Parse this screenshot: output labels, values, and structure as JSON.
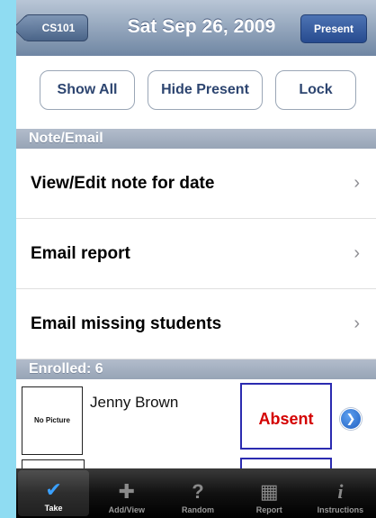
{
  "navbar": {
    "back_label": "CS101",
    "title": "Sat Sep 26, 2009",
    "present_label": "Present"
  },
  "actions": {
    "show_all": "Show All",
    "hide_present": "Hide Present",
    "lock": "Lock"
  },
  "note_section": {
    "header": "Note/Email",
    "items": [
      {
        "label": "View/Edit note for date"
      },
      {
        "label": "Email report"
      },
      {
        "label": "Email missing students"
      }
    ]
  },
  "enrolled": {
    "header": "Enrolled: 6",
    "students": [
      {
        "name": "Jenny Brown",
        "picture_text": "No Picture",
        "status": "Absent"
      }
    ]
  },
  "tabbar": {
    "tabs": [
      {
        "label": "Take",
        "icon": "checkmark-icon",
        "active": true
      },
      {
        "label": "Add/View",
        "icon": "add-person-icon",
        "active": false
      },
      {
        "label": "Random",
        "icon": "question-icon",
        "active": false
      },
      {
        "label": "Report",
        "icon": "grid-icon",
        "active": false
      },
      {
        "label": "Instructions",
        "icon": "info-icon",
        "active": false
      }
    ]
  },
  "colors": {
    "background": "#8fdcf2",
    "absent_text": "#d40000",
    "absent_border": "#2b2bb0",
    "tab_active": "#3aa0ff"
  }
}
